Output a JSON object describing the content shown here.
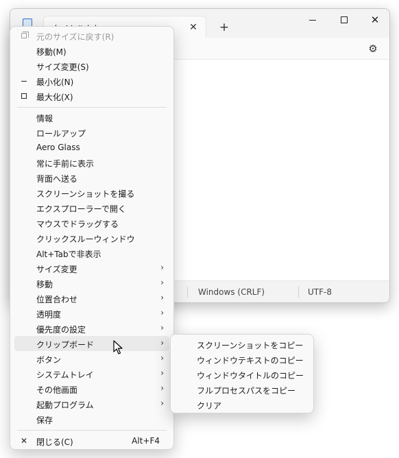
{
  "window": {
    "tab_title": "タイトルなし",
    "status": {
      "line_ending": "Windows (CRLF)",
      "encoding": "UTF-8"
    }
  },
  "system_menu": {
    "items": [
      {
        "label": "元のサイズに戻す(R)",
        "disabled": true,
        "icon": "restore-icon"
      },
      {
        "label": "移動(M)"
      },
      {
        "label": "サイズ変更(S)"
      },
      {
        "label": "最小化(N)",
        "icon": "minimize-icon"
      },
      {
        "label": "最大化(X)",
        "icon": "maximize-icon"
      }
    ],
    "extra_items": [
      {
        "label": "情報"
      },
      {
        "label": "ロールアップ"
      },
      {
        "label": "Aero Glass"
      },
      {
        "label": "常に手前に表示"
      },
      {
        "label": "背面へ送る"
      },
      {
        "label": "スクリーンショットを撮る"
      },
      {
        "label": "エクスプローラーで開く"
      },
      {
        "label": "マウスでドラッグする"
      },
      {
        "label": "クリックスルーウィンドウ"
      },
      {
        "label": "Alt+Tabで非表示"
      },
      {
        "label": "サイズ変更",
        "submenu": true
      },
      {
        "label": "移動",
        "submenu": true
      },
      {
        "label": "位置合わせ",
        "submenu": true
      },
      {
        "label": "透明度",
        "submenu": true
      },
      {
        "label": "優先度の設定",
        "submenu": true
      },
      {
        "label": "クリップボード",
        "submenu": true,
        "highlighted": true
      },
      {
        "label": "ボタン",
        "submenu": true
      },
      {
        "label": "システムトレイ",
        "submenu": true
      },
      {
        "label": "その他画面",
        "submenu": true
      },
      {
        "label": "起動プログラム",
        "submenu": true
      },
      {
        "label": "保存"
      }
    ],
    "close": {
      "label": "閉じる(C)",
      "shortcut": "Alt+F4",
      "icon": "close-icon"
    }
  },
  "clipboard_submenu": {
    "items": [
      {
        "label": "スクリーンショットをコピー"
      },
      {
        "label": "ウィンドウテキストのコピー"
      },
      {
        "label": "ウィンドウタイトルのコピー"
      },
      {
        "label": "フルプロセスパスをコピー"
      },
      {
        "label": "クリア"
      }
    ]
  },
  "colors": {
    "menu_bg": "#f9f9f9",
    "hover_bg": "#eaeaea",
    "disabled_text": "#9a9a9a"
  }
}
